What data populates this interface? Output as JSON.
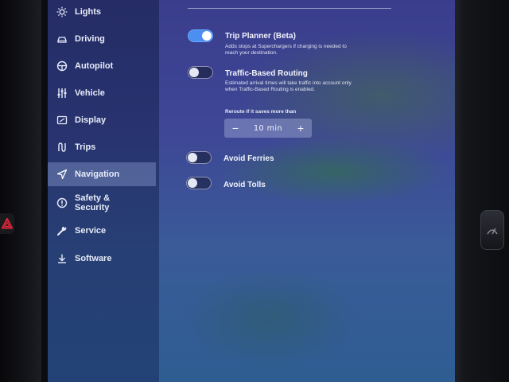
{
  "sidebar": {
    "items": [
      {
        "label": "Lights",
        "icon": "sun-icon"
      },
      {
        "label": "Driving",
        "icon": "car-icon"
      },
      {
        "label": "Autopilot",
        "icon": "steering-wheel-icon"
      },
      {
        "label": "Vehicle",
        "icon": "sliders-icon"
      },
      {
        "label": "Display",
        "icon": "display-icon"
      },
      {
        "label": "Trips",
        "icon": "trips-icon"
      },
      {
        "label": "Navigation",
        "icon": "navigation-arrow-icon",
        "active": true
      },
      {
        "label": "Safety &\nSecurity",
        "icon": "alert-circle-icon"
      },
      {
        "label": "Service",
        "icon": "wrench-icon"
      },
      {
        "label": "Software",
        "icon": "download-icon"
      }
    ]
  },
  "navigation": {
    "trip_planner": {
      "title": "Trip Planner (Beta)",
      "description": "Adds stops at Superchargers if charging is needed to reach your destination.",
      "enabled": true
    },
    "traffic_routing": {
      "title": "Traffic-Based Routing",
      "description": "Estimated arrival times will take traffic into account only when Traffic-Based Routing is enabled.",
      "enabled": false,
      "reroute_label": "Reroute if it saves more than",
      "minus_label": "−",
      "plus_label": "+",
      "reroute_value": "10 min"
    },
    "avoid_ferries": {
      "title": "Avoid Ferries",
      "enabled": false
    },
    "avoid_tolls": {
      "title": "Avoid Tolls",
      "enabled": false
    }
  },
  "colors": {
    "toggle_on": "#4c8ff0",
    "active_nav_bg": "#b4c8f5",
    "hazard_red": "#e0253a"
  }
}
